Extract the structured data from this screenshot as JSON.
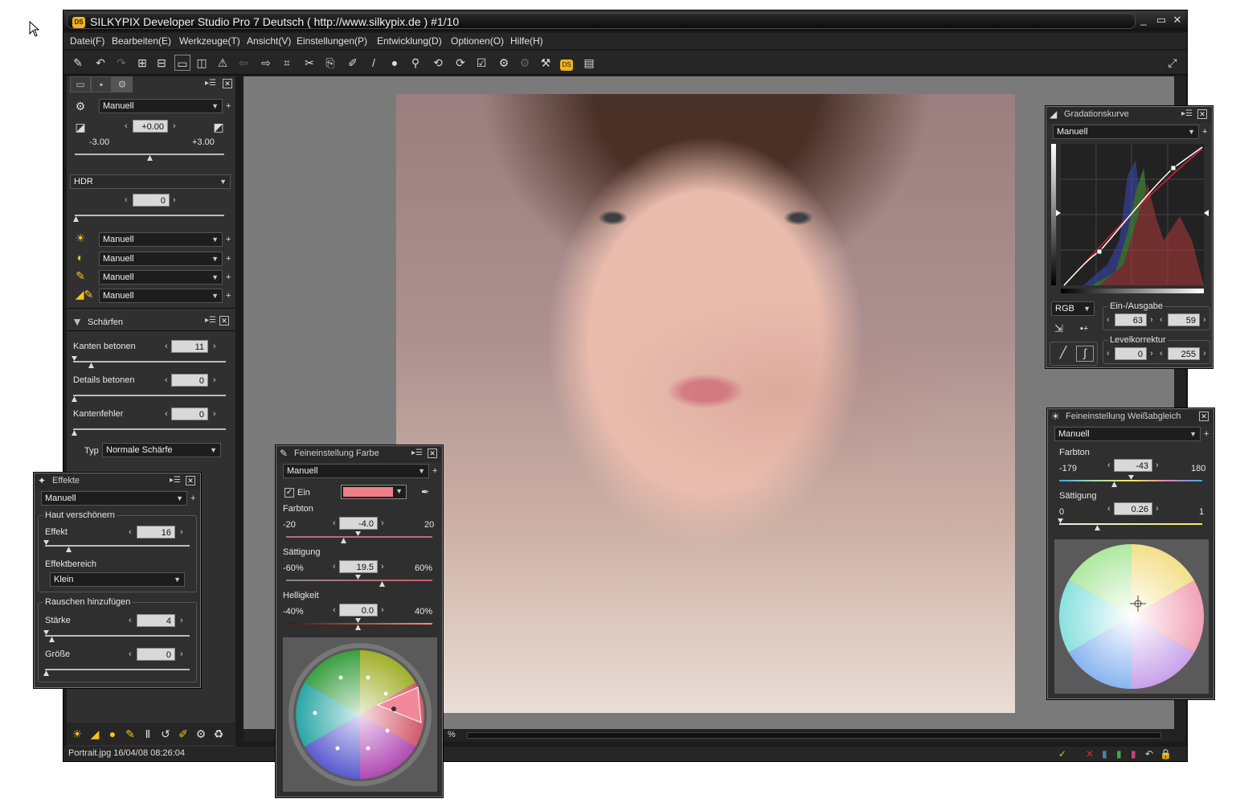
{
  "window": {
    "title": "SILKYPIX Developer Studio Pro 7 Deutsch ( http://www.silkypix.de )   #1/10",
    "app_badge": "DS"
  },
  "menu": [
    "Datei(F)",
    "Bearbeiten(E)",
    "Werkzeuge(T)",
    "Ansicht(V)",
    "Einstellungen(P)",
    "Entwicklung(D)",
    "Optionen(O)",
    "Hilfe(H)"
  ],
  "left_panel": {
    "preset": "Manuell",
    "exposure": {
      "value": "+0.00",
      "min": "-3.00",
      "max": "+3.00"
    },
    "hdr": {
      "label": "HDR",
      "value": "0"
    },
    "rows": [
      "Manuell",
      "Manuell",
      "Manuell",
      "Manuell"
    ],
    "sharpen": {
      "title": "Schärfen",
      "kanten_label": "Kanten betonen",
      "kanten_value": "11",
      "details_label": "Details betonen",
      "details_value": "0",
      "fehler_label": "Kantenfehler",
      "fehler_value": "0",
      "typ_label": "Typ",
      "typ_value": "Normale Schärfe"
    }
  },
  "effects_panel": {
    "title": "Effekte",
    "preset": "Manuell",
    "haut_title": "Haut verschönern",
    "effekt_label": "Effekt",
    "effekt_value": "16",
    "bereich_label": "Effektbereich",
    "bereich_value": "Klein",
    "rauschen_title": "Rauschen hinzufügen",
    "staerke_label": "Stärke",
    "staerke_value": "4",
    "groesse_label": "Größe",
    "groesse_value": "0"
  },
  "color_panel": {
    "title": "Feineinstellung Farbe",
    "preset": "Manuell",
    "ein_label": "Ein",
    "swatch_color": "#ef7f86",
    "farbton_label": "Farbton",
    "farbton_min": "-20",
    "farbton_value": "-4.0",
    "farbton_max": "20",
    "saettigung_label": "Sättigung",
    "saettigung_min": "-60%",
    "saettigung_value": "19.5",
    "saettigung_max": "60%",
    "helligkeit_label": "Helligkeit",
    "helligkeit_min": "-40%",
    "helligkeit_value": "0.0",
    "helligkeit_max": "40%"
  },
  "curve_panel": {
    "title": "Gradationskurve",
    "preset": "Manuell",
    "channel": "RGB",
    "inout_title": "Ein-/Ausgabe",
    "in_value": "63",
    "out_value": "59",
    "level_title": "Levelkorrektur",
    "level_min": "0",
    "level_max": "255"
  },
  "wb_panel": {
    "title": "Feineinstellung Weißabgleich",
    "preset": "Manuell",
    "farbton_label": "Farbton",
    "farbton_min": "-179",
    "farbton_value": "-43",
    "farbton_max": "180",
    "saettigung_label": "Sättigung",
    "saettigung_min": "0",
    "saettigung_value": "0.26",
    "saettigung_max": "1"
  },
  "status": {
    "text": "Portrait.jpg 16/04/08 08:26:04",
    "zoom_suffix": "%"
  }
}
